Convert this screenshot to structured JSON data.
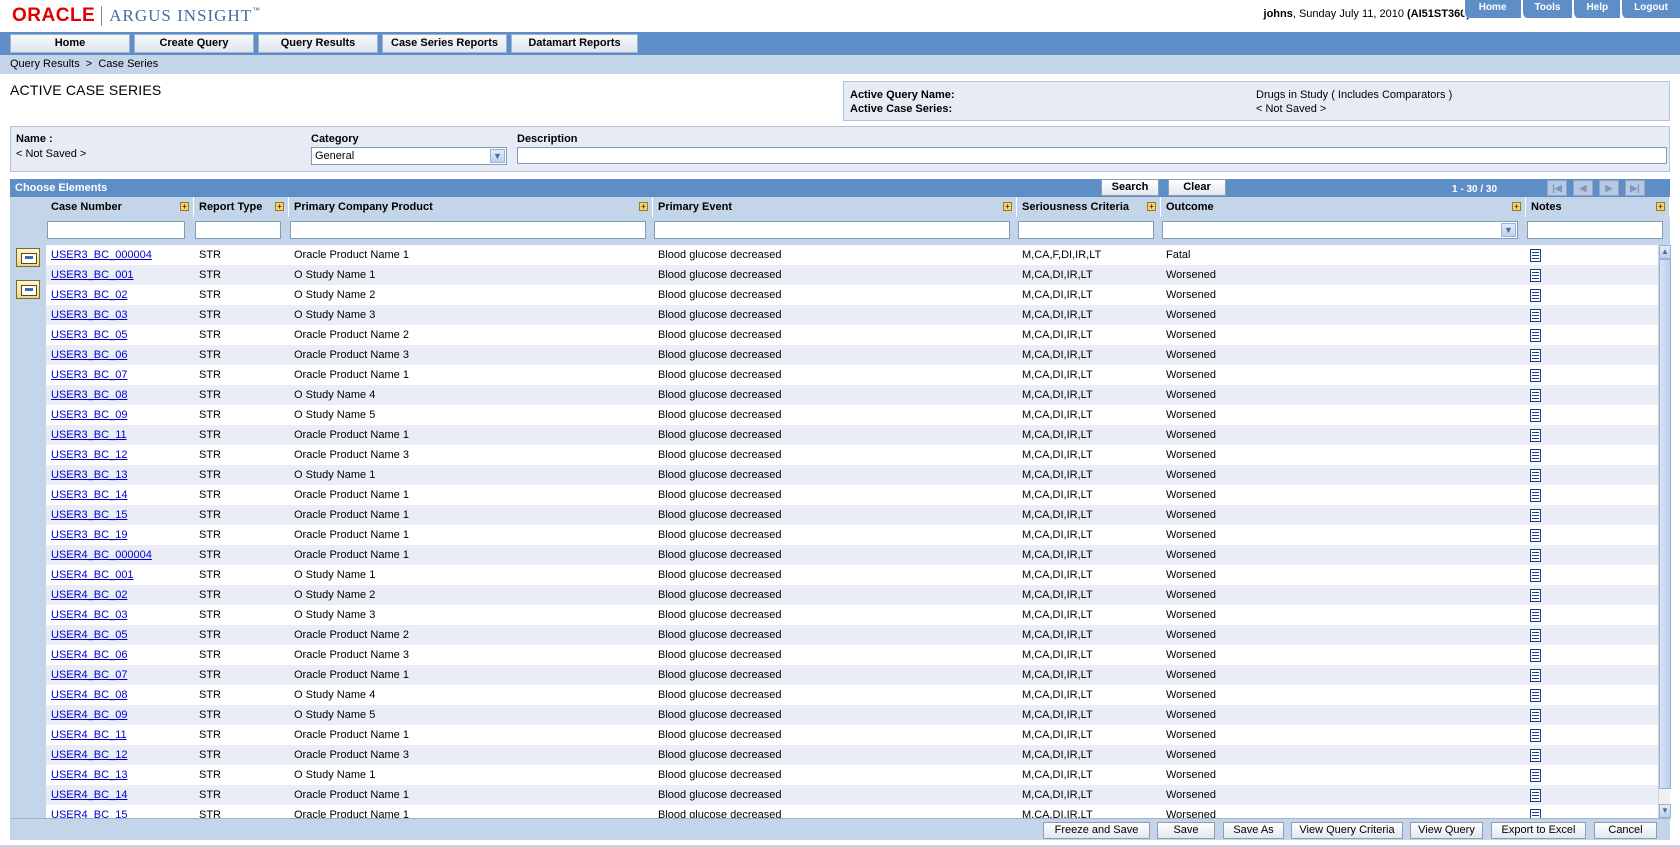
{
  "header": {
    "brand": "ORACLE",
    "product": "ARGUS INSIGHT",
    "trademark": "™",
    "user": "johns",
    "date": ", Sunday July 11, 2010 ",
    "server": "(AI51ST360)",
    "links": [
      "Home",
      "Tools",
      "Help",
      "Logout"
    ]
  },
  "nav": {
    "tabs": [
      "Home",
      "Create Query",
      "Query Results",
      "Case Series Reports",
      "Datamart Reports"
    ]
  },
  "breadcrumb": "Query Results  >  Case Series",
  "page": {
    "title": "ACTIVE CASE SERIES",
    "active_query_label": "Active Query Name:",
    "active_query_value": "Drugs in Study ( Includes Comparators )",
    "active_series_label": "Active Case Series:",
    "active_series_value": "< Not Saved >"
  },
  "form": {
    "name_label": "Name :",
    "name_value": "< Not Saved >",
    "category_label": "Category",
    "category_value": "General",
    "description_label": "Description",
    "description_value": ""
  },
  "grid": {
    "panel_title": "Choose Elements",
    "search_label": "Search",
    "clear_label": "Clear",
    "pager_text": "1 - 30 / 30",
    "columns": [
      "Case Number",
      "Report Type",
      "Primary Company Product",
      "Primary Event",
      "Seriousness Criteria",
      "Outcome",
      "Notes"
    ],
    "rows": [
      {
        "case": "USER3_BC_000004",
        "type": "STR",
        "product": "Oracle Product Name 1",
        "event": "Blood glucose decreased",
        "criteria": "M,CA,F,DI,IR,LT",
        "outcome": "Fatal"
      },
      {
        "case": "USER3_BC_001",
        "type": "STR",
        "product": "O Study Name 1",
        "event": "Blood glucose decreased",
        "criteria": "M,CA,DI,IR,LT",
        "outcome": "Worsened"
      },
      {
        "case": "USER3_BC_02",
        "type": "STR",
        "product": "O Study Name 2",
        "event": "Blood glucose decreased",
        "criteria": "M,CA,DI,IR,LT",
        "outcome": "Worsened"
      },
      {
        "case": "USER3_BC_03",
        "type": "STR",
        "product": "O Study Name 3",
        "event": "Blood glucose decreased",
        "criteria": "M,CA,DI,IR,LT",
        "outcome": "Worsened"
      },
      {
        "case": "USER3_BC_05",
        "type": "STR",
        "product": "Oracle Product Name 2",
        "event": "Blood glucose decreased",
        "criteria": "M,CA,DI,IR,LT",
        "outcome": "Worsened"
      },
      {
        "case": "USER3_BC_06",
        "type": "STR",
        "product": "Oracle Product Name 3",
        "event": "Blood glucose decreased",
        "criteria": "M,CA,DI,IR,LT",
        "outcome": "Worsened"
      },
      {
        "case": "USER3_BC_07",
        "type": "STR",
        "product": "Oracle Product Name 1",
        "event": "Blood glucose decreased",
        "criteria": "M,CA,DI,IR,LT",
        "outcome": "Worsened"
      },
      {
        "case": "USER3_BC_08",
        "type": "STR",
        "product": "O Study Name 4",
        "event": "Blood glucose decreased",
        "criteria": "M,CA,DI,IR,LT",
        "outcome": "Worsened"
      },
      {
        "case": "USER3_BC_09",
        "type": "STR",
        "product": "O Study Name 5",
        "event": "Blood glucose decreased",
        "criteria": "M,CA,DI,IR,LT",
        "outcome": "Worsened"
      },
      {
        "case": "USER3_BC_11",
        "type": "STR",
        "product": "Oracle Product Name 1",
        "event": "Blood glucose decreased",
        "criteria": "M,CA,DI,IR,LT",
        "outcome": "Worsened"
      },
      {
        "case": "USER3_BC_12",
        "type": "STR",
        "product": "Oracle Product Name 3",
        "event": "Blood glucose decreased",
        "criteria": "M,CA,DI,IR,LT",
        "outcome": "Worsened"
      },
      {
        "case": "USER3_BC_13",
        "type": "STR",
        "product": "O Study Name 1",
        "event": "Blood glucose decreased",
        "criteria": "M,CA,DI,IR,LT",
        "outcome": "Worsened"
      },
      {
        "case": "USER3_BC_14",
        "type": "STR",
        "product": "Oracle Product Name 1",
        "event": "Blood glucose decreased",
        "criteria": "M,CA,DI,IR,LT",
        "outcome": "Worsened"
      },
      {
        "case": "USER3_BC_15",
        "type": "STR",
        "product": "Oracle Product Name 1",
        "event": "Blood glucose decreased",
        "criteria": "M,CA,DI,IR,LT",
        "outcome": "Worsened"
      },
      {
        "case": "USER3_BC_19",
        "type": "STR",
        "product": "Oracle Product Name 1",
        "event": "Blood glucose decreased",
        "criteria": "M,CA,DI,IR,LT",
        "outcome": "Worsened"
      },
      {
        "case": "USER4_BC_000004",
        "type": "STR",
        "product": "Oracle Product Name 1",
        "event": "Blood glucose decreased",
        "criteria": "M,CA,DI,IR,LT",
        "outcome": "Worsened"
      },
      {
        "case": "USER4_BC_001",
        "type": "STR",
        "product": "O Study Name 1",
        "event": "Blood glucose decreased",
        "criteria": "M,CA,DI,IR,LT",
        "outcome": "Worsened"
      },
      {
        "case": "USER4_BC_02",
        "type": "STR",
        "product": "O Study Name 2",
        "event": "Blood glucose decreased",
        "criteria": "M,CA,DI,IR,LT",
        "outcome": "Worsened"
      },
      {
        "case": "USER4_BC_03",
        "type": "STR",
        "product": "O Study Name 3",
        "event": "Blood glucose decreased",
        "criteria": "M,CA,DI,IR,LT",
        "outcome": "Worsened"
      },
      {
        "case": "USER4_BC_05",
        "type": "STR",
        "product": "Oracle Product Name 2",
        "event": "Blood glucose decreased",
        "criteria": "M,CA,DI,IR,LT",
        "outcome": "Worsened"
      },
      {
        "case": "USER4_BC_06",
        "type": "STR",
        "product": "Oracle Product Name 3",
        "event": "Blood glucose decreased",
        "criteria": "M,CA,DI,IR,LT",
        "outcome": "Worsened"
      },
      {
        "case": "USER4_BC_07",
        "type": "STR",
        "product": "Oracle Product Name 1",
        "event": "Blood glucose decreased",
        "criteria": "M,CA,DI,IR,LT",
        "outcome": "Worsened"
      },
      {
        "case": "USER4_BC_08",
        "type": "STR",
        "product": "O Study Name 4",
        "event": "Blood glucose decreased",
        "criteria": "M,CA,DI,IR,LT",
        "outcome": "Worsened"
      },
      {
        "case": "USER4_BC_09",
        "type": "STR",
        "product": "O Study Name 5",
        "event": "Blood glucose decreased",
        "criteria": "M,CA,DI,IR,LT",
        "outcome": "Worsened"
      },
      {
        "case": "USER4_BC_11",
        "type": "STR",
        "product": "Oracle Product Name 1",
        "event": "Blood glucose decreased",
        "criteria": "M,CA,DI,IR,LT",
        "outcome": "Worsened"
      },
      {
        "case": "USER4_BC_12",
        "type": "STR",
        "product": "Oracle Product Name 3",
        "event": "Blood glucose decreased",
        "criteria": "M,CA,DI,IR,LT",
        "outcome": "Worsened"
      },
      {
        "case": "USER4_BC_13",
        "type": "STR",
        "product": "O Study Name 1",
        "event": "Blood glucose decreased",
        "criteria": "M,CA,DI,IR,LT",
        "outcome": "Worsened"
      },
      {
        "case": "USER4_BC_14",
        "type": "STR",
        "product": "Oracle Product Name 1",
        "event": "Blood glucose decreased",
        "criteria": "M,CA,DI,IR,LT",
        "outcome": "Worsened"
      },
      {
        "case": "USER4_BC_15",
        "type": "STR",
        "product": "Oracle Product Name 1",
        "event": "Blood glucose decreased",
        "criteria": "M,CA,DI,IR,LT",
        "outcome": "Worsened"
      }
    ]
  },
  "footer": {
    "buttons": [
      "Freeze and Save",
      "Save",
      "Save As",
      "View Query Criteria",
      "View Query",
      "Export to Excel",
      "Cancel"
    ]
  },
  "colors": {
    "brand_red": "#e00000",
    "nav_blue": "#5d8ec7",
    "band_light": "#c4d5ea",
    "row_alt": "#eaedf6",
    "link": "#0000cc"
  }
}
